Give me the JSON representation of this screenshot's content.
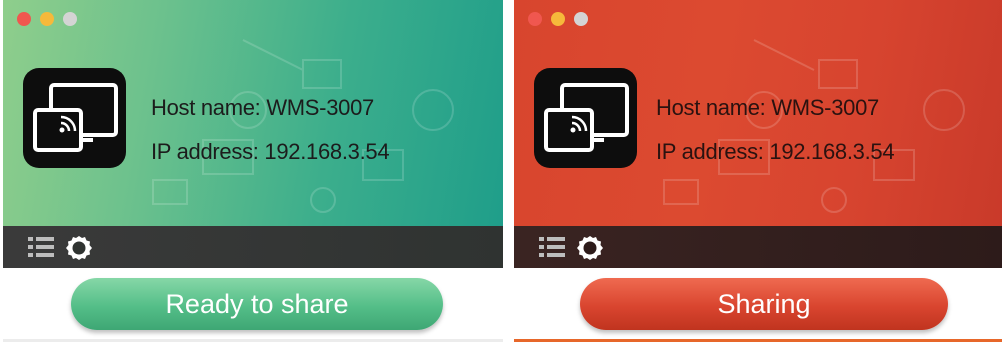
{
  "panels": [
    {
      "state": "idle",
      "host_label": "Host name:",
      "host_value": "WMS-3007",
      "ip_label": "IP address:",
      "ip_value": "192.168.3.54",
      "action_label": "Ready to share",
      "colors": {
        "theme_start": "#8fce8c",
        "theme_end": "#1f9e8a",
        "button": "#54be88"
      }
    },
    {
      "state": "sharing",
      "host_label": "Host name:",
      "host_value": "WMS-3007",
      "ip_label": "IP address:",
      "ip_value": "192.168.3.54",
      "action_label": "Sharing",
      "colors": {
        "theme_start": "#d8452e",
        "theme_end": "#c93a2a",
        "button": "#d9452f"
      }
    }
  ],
  "icons": {
    "window_controls": [
      "close-dot",
      "minimize-dot",
      "zoom-dot"
    ],
    "app_icon": "screen-cast-icon",
    "toolbar": [
      "list-icon",
      "gear-icon"
    ]
  }
}
